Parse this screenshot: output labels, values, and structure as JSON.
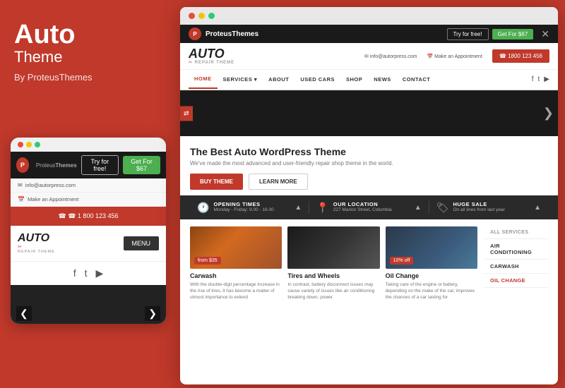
{
  "left": {
    "title": "Auto",
    "subtitle": "Theme",
    "byline": "By ProteusThemes"
  },
  "mobile": {
    "dots": [
      "#e74c3c",
      "#f1c40f",
      "#2ecc71"
    ],
    "logo_letter": "P",
    "brand_plain": "Proteus",
    "brand_bold": "Themes",
    "try_label": "Try for free!",
    "get_label": "Get For $67",
    "info_email": "✉ info@autorpress.com",
    "info_appt": "📅 Make an Appointment",
    "phone": "☎ 1 800 123 456",
    "auto_text": "AUTO",
    "repair_text": "✂ REPAIR THEME",
    "menu_label": "MENU",
    "arrow_left": "❮",
    "arrow_right": "❯"
  },
  "browser": {
    "dots": [
      "#e74c3c",
      "#f1c40f",
      "#2ecc71"
    ],
    "topbar": {
      "logo_letter": "P",
      "brand": "Proteus",
      "brand_bold": "Themes",
      "try_label": "Try for free!",
      "get_label": "Get For $67",
      "close": "✕"
    },
    "header": {
      "auto_text": "AUTO",
      "repair_text": "REPAIR THEME",
      "email": "✉ info@autorpress.com",
      "appointment": "📅 Make an Appointment",
      "phone": "☎ 1800 123 456"
    },
    "nav": {
      "items": [
        "HOME",
        "SERVICES",
        "ABOUT",
        "USED CARS",
        "SHOP",
        "NEWS",
        "CONTACT"
      ],
      "active_index": 0
    },
    "hero": {
      "share_icon": "⇄",
      "arrow_left": "❮",
      "arrow_right": "❯"
    },
    "main": {
      "title": "The Best Auto WordPress Theme",
      "subtitle": "We've made the most advanced and user-friendly repair shop theme in the world.",
      "buy_label": "BUY THEME",
      "learn_label": "LEARN MORE"
    },
    "infobar": {
      "items": [
        {
          "icon": "🕐",
          "title": "OPENING TIMES",
          "sub": "Monday - Friday: 9.00 - 16.00"
        },
        {
          "icon": "📍",
          "title": "OUR LOCATION",
          "sub": "227 Marion Street, Columbia"
        },
        {
          "icon": "🏷",
          "title": "HUGE SALE",
          "sub": "On all lines from last year"
        }
      ]
    },
    "services": {
      "cards": [
        {
          "title": "Carwash",
          "badge": "from $35",
          "text": "With the double-digit percentage increase in the rise of tires, it has become a matter of utmost importance to extend"
        },
        {
          "title": "Tires and Wheels",
          "badge": "",
          "text": "In contrast, battery disconnect issues may cause variety of issues like air conditioning breaking down, power"
        },
        {
          "title": "Oil Change",
          "badge": "10% off",
          "text": "Taking care of the engine or battery, depending on the make of the car, improves the chances of a car lasting for"
        }
      ],
      "sidebar_items": [
        "ALL SERVICES",
        "AIR CONDITIONING",
        "CARWASH",
        "OIL CHANGE"
      ]
    }
  }
}
